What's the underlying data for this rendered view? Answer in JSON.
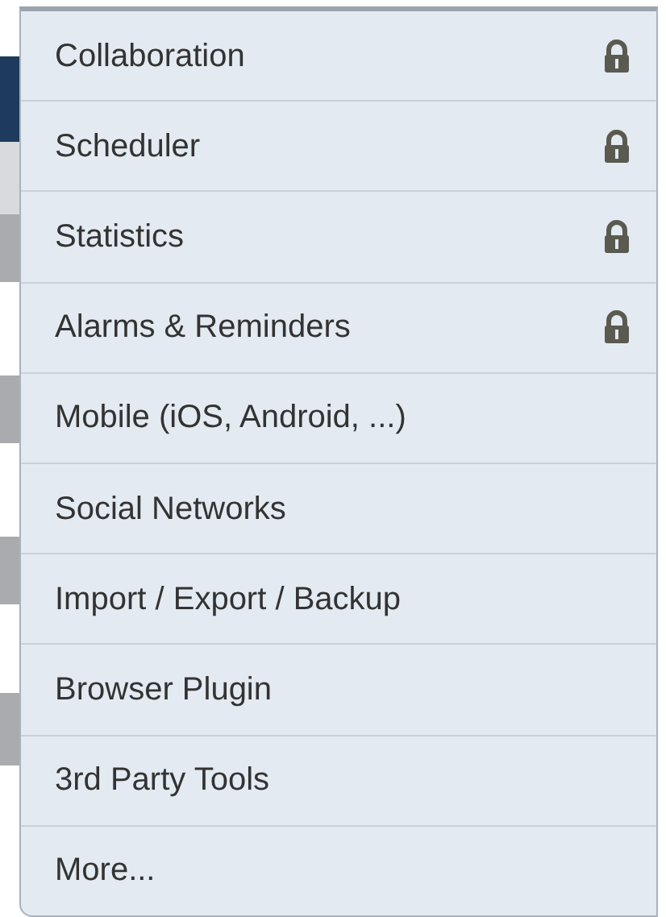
{
  "menu": {
    "items": [
      {
        "label": "Collaboration",
        "locked": true
      },
      {
        "label": "Scheduler",
        "locked": true
      },
      {
        "label": "Statistics",
        "locked": true
      },
      {
        "label": "Alarms & Reminders",
        "locked": true
      },
      {
        "label": "Mobile (iOS, Android, ...)",
        "locked": false
      },
      {
        "label": "Social Networks",
        "locked": false
      },
      {
        "label": "Import / Export / Backup",
        "locked": false
      },
      {
        "label": "Browser Plugin",
        "locked": false
      },
      {
        "label": "3rd Party Tools",
        "locked": false
      },
      {
        "label": "More...",
        "locked": false
      }
    ]
  }
}
